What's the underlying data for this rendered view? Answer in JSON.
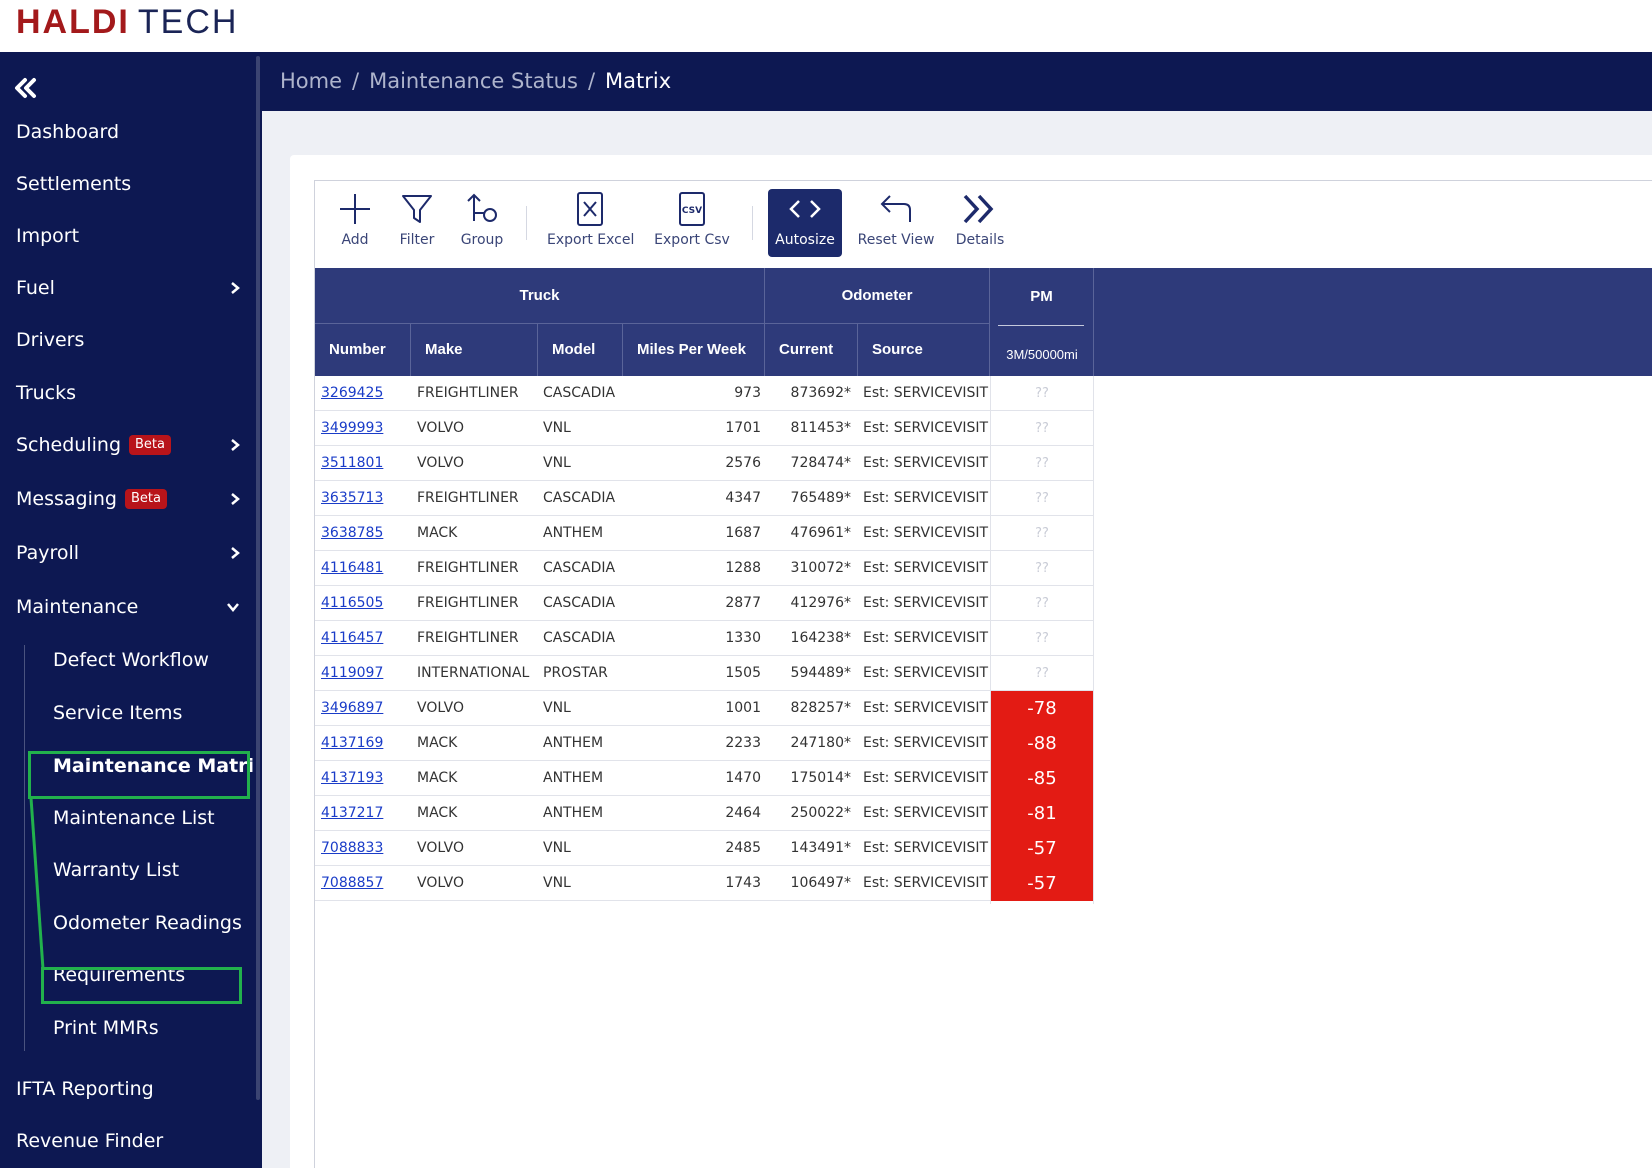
{
  "logo": {
    "part1": "HALDI",
    "part2": "TECH"
  },
  "sidebar": {
    "items": [
      {
        "label": "Dashboard"
      },
      {
        "label": "Settlements"
      },
      {
        "label": "Import"
      },
      {
        "label": "Fuel"
      },
      {
        "label": "Drivers"
      },
      {
        "label": "Trucks"
      },
      {
        "label": "Scheduling",
        "badge": "Beta"
      },
      {
        "label": "Messaging",
        "badge": "Beta"
      },
      {
        "label": "Payroll"
      },
      {
        "label": "Maintenance"
      },
      {
        "label": "IFTA Reporting"
      },
      {
        "label": "Revenue Finder"
      }
    ],
    "maintenance_sub": [
      {
        "label": "Defect Workflow"
      },
      {
        "label": "Service Items"
      },
      {
        "label": "Maintenance Matrix"
      },
      {
        "label": "Maintenance List"
      },
      {
        "label": "Warranty List"
      },
      {
        "label": "Odometer Readings"
      },
      {
        "label": "Requirements"
      },
      {
        "label": "Print MMRs"
      }
    ]
  },
  "breadcrumb": {
    "home": "Home",
    "status": "Maintenance Status",
    "current": "Matrix",
    "sep": "/"
  },
  "toolbar": {
    "add": "Add",
    "filter": "Filter",
    "group": "Group",
    "export_excel": "Export Excel",
    "export_csv": "Export Csv",
    "csv_icon_text": "CSV",
    "autosize": "Autosize",
    "reset_view": "Reset View",
    "details": "Details"
  },
  "table": {
    "groups": {
      "truck": "Truck",
      "odometer": "Odometer",
      "pm": "PM"
    },
    "columns": {
      "number": "Number",
      "make": "Make",
      "model": "Model",
      "mpw": "Miles Per Week",
      "current": "Current",
      "source": "Source",
      "pm_sub": "3M/50000mi"
    },
    "rows": [
      {
        "number": "3269425",
        "make": "FREIGHTLINER",
        "model": "CASCADIA",
        "mpw": "973",
        "current": "873692*",
        "source": "Est: SERVICEVISIT",
        "pm": "??",
        "pm_status": "unknown"
      },
      {
        "number": "3499993",
        "make": "VOLVO",
        "model": "VNL",
        "mpw": "1701",
        "current": "811453*",
        "source": "Est: SERVICEVISIT",
        "pm": "??",
        "pm_status": "unknown"
      },
      {
        "number": "3511801",
        "make": "VOLVO",
        "model": "VNL",
        "mpw": "2576",
        "current": "728474*",
        "source": "Est: SERVICEVISIT",
        "pm": "??",
        "pm_status": "unknown"
      },
      {
        "number": "3635713",
        "make": "FREIGHTLINER",
        "model": "CASCADIA",
        "mpw": "4347",
        "current": "765489*",
        "source": "Est: SERVICEVISIT",
        "pm": "??",
        "pm_status": "unknown"
      },
      {
        "number": "3638785",
        "make": "MACK",
        "model": "ANTHEM",
        "mpw": "1687",
        "current": "476961*",
        "source": "Est: SERVICEVISIT",
        "pm": "??",
        "pm_status": "unknown"
      },
      {
        "number": "4116481",
        "make": "FREIGHTLINER",
        "model": "CASCADIA",
        "mpw": "1288",
        "current": "310072*",
        "source": "Est: SERVICEVISIT",
        "pm": "??",
        "pm_status": "unknown"
      },
      {
        "number": "4116505",
        "make": "FREIGHTLINER",
        "model": "CASCADIA",
        "mpw": "2877",
        "current": "412976*",
        "source": "Est: SERVICEVISIT",
        "pm": "??",
        "pm_status": "unknown"
      },
      {
        "number": "4116457",
        "make": "FREIGHTLINER",
        "model": "CASCADIA",
        "mpw": "1330",
        "current": "164238*",
        "source": "Est: SERVICEVISIT",
        "pm": "??",
        "pm_status": "unknown"
      },
      {
        "number": "4119097",
        "make": "INTERNATIONAL",
        "model": "PROSTAR",
        "mpw": "1505",
        "current": "594489*",
        "source": "Est: SERVICEVISIT",
        "pm": "??",
        "pm_status": "unknown"
      },
      {
        "number": "3496897",
        "make": "VOLVO",
        "model": "VNL",
        "mpw": "1001",
        "current": "828257*",
        "source": "Est: SERVICEVISIT",
        "pm": "-78",
        "pm_status": "over"
      },
      {
        "number": "4137169",
        "make": "MACK",
        "model": "ANTHEM",
        "mpw": "2233",
        "current": "247180*",
        "source": "Est: SERVICEVISIT",
        "pm": "-88",
        "pm_status": "over"
      },
      {
        "number": "4137193",
        "make": "MACK",
        "model": "ANTHEM",
        "mpw": "1470",
        "current": "175014*",
        "source": "Est: SERVICEVISIT",
        "pm": "-85",
        "pm_status": "over"
      },
      {
        "number": "4137217",
        "make": "MACK",
        "model": "ANTHEM",
        "mpw": "2464",
        "current": "250022*",
        "source": "Est: SERVICEVISIT",
        "pm": "-81",
        "pm_status": "over"
      },
      {
        "number": "7088833",
        "make": "VOLVO",
        "model": "VNL",
        "mpw": "2485",
        "current": "143491*",
        "source": "Est: SERVICEVISIT",
        "pm": "-57",
        "pm_status": "over"
      },
      {
        "number": "7088857",
        "make": "VOLVO",
        "model": "VNL",
        "mpw": "1743",
        "current": "106497*",
        "source": "Est: SERVICEVISIT",
        "pm": "-57",
        "pm_status": "over"
      }
    ]
  },
  "colors": {
    "nav_bg": "#0d1852",
    "header_bg": "#2e3a7a",
    "overdue": "#e31b14",
    "highlight": "#22b14c"
  }
}
